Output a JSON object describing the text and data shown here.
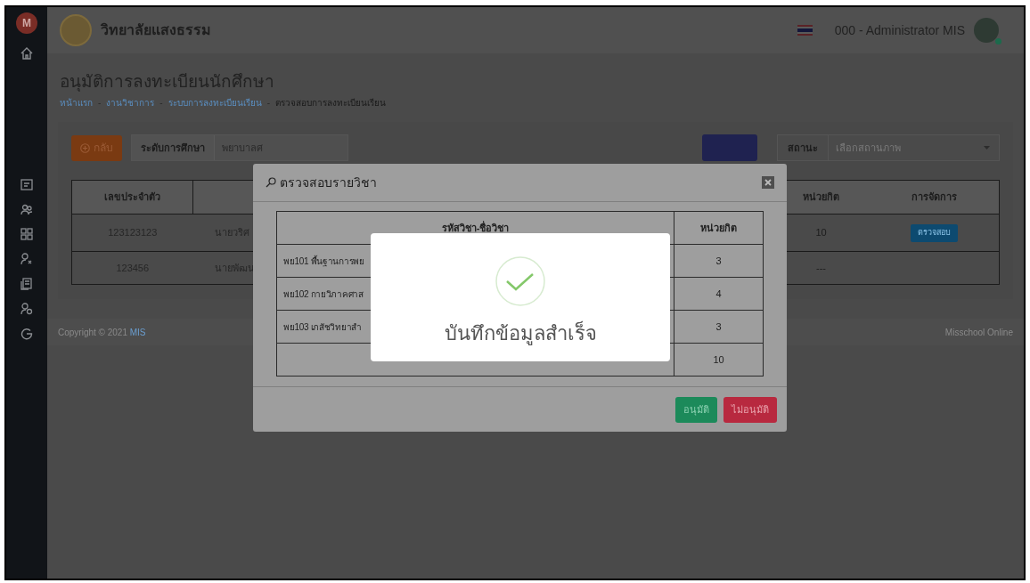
{
  "sidebar": {
    "logo": "M"
  },
  "header": {
    "school_name": "วิทยาลัยแสงธรรม",
    "user": "000 - Administrator MIS"
  },
  "page": {
    "title": "อนุมัติการลงทะเบียนนักศึกษา",
    "separator": "-",
    "breadcrumb": [
      {
        "label": "หน้าแรก",
        "link": true
      },
      {
        "label": "งานวิชาการ",
        "link": true
      },
      {
        "label": "ระบบการลงทะเบียนเรียน",
        "link": true
      },
      {
        "label": "ตรวจสอบการลงทะเบียนเรียน",
        "link": false
      }
    ]
  },
  "filters": {
    "back_button": "กลับ",
    "level_label": "ระดับการศึกษา",
    "level_value": "พยาบาลศ",
    "status_label": "สถานะ",
    "status_placeholder": "เลือกสถานภาพ"
  },
  "table": {
    "columns": [
      "เลขประจำตัว",
      "หน่วยกิต",
      "การจัดการ"
    ],
    "rows": [
      {
        "id": "123123123",
        "name": "นายวริศ",
        "credits": "10",
        "action": "ตรวจสอบ"
      },
      {
        "id": "123456",
        "name": "นายพัฒน",
        "credits": "---"
      }
    ]
  },
  "footer": {
    "copyright": "Copyright © 2021",
    "link": "MIS",
    "right": "Misschool Online"
  },
  "modal": {
    "title": "ตรวจสอบรายวิชา",
    "columns": [
      "รหัสวิชา-ชื่อวิชา",
      "หน่วยกิต"
    ],
    "rows": [
      {
        "course": "พย101 พื้นฐานการพย",
        "credits": "3"
      },
      {
        "course": "พย102 กายวิภาคศาส",
        "credits": "4"
      },
      {
        "course": "พย103 เภสัชวิทยาสำ",
        "credits": "3"
      }
    ],
    "total": "10",
    "buttons": [
      {
        "label": "อนุมัติ",
        "kind": "approve"
      },
      {
        "label": "ไม่อนุมัติ",
        "kind": "reject"
      }
    ]
  },
  "alert": {
    "message": "บันทึกข้อมูลสำเร็จ"
  }
}
